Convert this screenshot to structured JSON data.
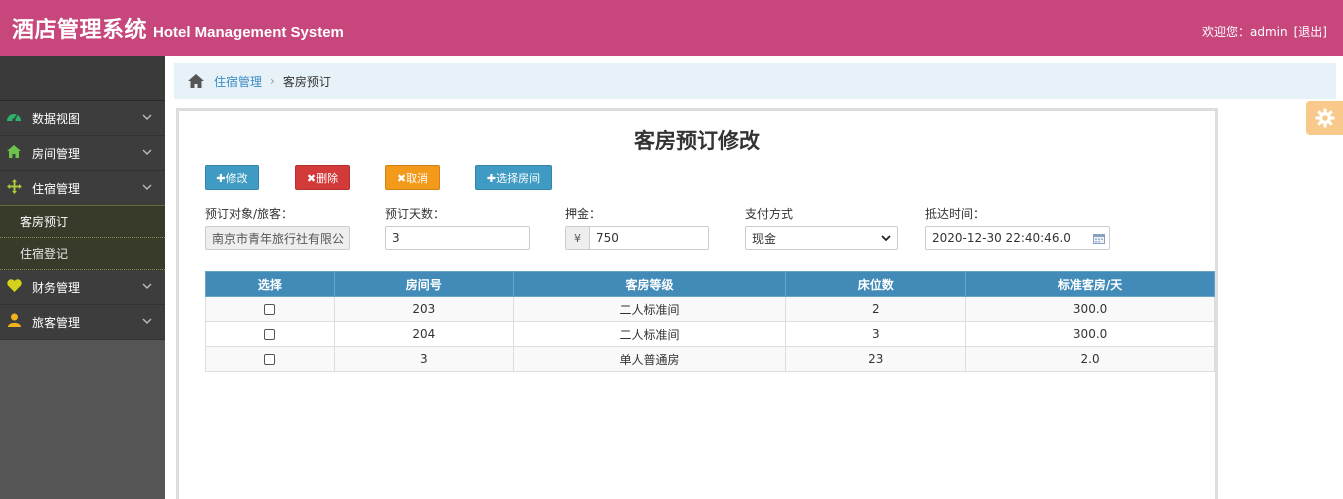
{
  "header": {
    "title_cn": "酒店管理系统",
    "title_en": "Hotel Management System",
    "welcome": "欢迎您：admin",
    "logout": "[退出]",
    "bg_color": "#c7477c"
  },
  "sidebar": {
    "items": [
      {
        "label": "数据视图",
        "icon": "dashboard-icon"
      },
      {
        "label": "房间管理",
        "icon": "home-icon"
      },
      {
        "label": "住宿管理",
        "icon": "move-icon",
        "open": true,
        "children": [
          {
            "label": "客房预订",
            "active": true
          },
          {
            "label": "住宿登记"
          }
        ]
      },
      {
        "label": "财务管理",
        "icon": "heart-icon"
      },
      {
        "label": "旅客管理",
        "icon": "user-icon"
      }
    ]
  },
  "breadcrumb": {
    "parent": "住宿管理",
    "current": "客房预订"
  },
  "page": {
    "title": "客房预订修改",
    "buttons": {
      "edit": "✚修改",
      "delete": "✖删除",
      "cancel": "✖取消",
      "select_room": "✚选择房间"
    },
    "form": {
      "guest_label": "预订对象/旅客：",
      "guest_value": "南京市青年旅行社有限公",
      "days_label": "预订天数：",
      "days_value": "3",
      "deposit_label": "押金：",
      "deposit_currency": "¥",
      "deposit_value": "750",
      "pay_label": "支付方式",
      "pay_value": "现金",
      "arrival_label": "抵达时间：",
      "arrival_value": "2020-12-30 22:40:46.0"
    },
    "table": {
      "headers": [
        "选择",
        "房间号",
        "客房等级",
        "床位数",
        "标准客房/天"
      ],
      "rows": [
        {
          "room": "203",
          "grade": "二人标准间",
          "beds": "2",
          "price": "300.0"
        },
        {
          "room": "204",
          "grade": "二人标准间",
          "beds": "3",
          "price": "300.0"
        },
        {
          "room": "3",
          "grade": "单人普通房",
          "beds": "23",
          "price": "2.0"
        }
      ]
    }
  }
}
